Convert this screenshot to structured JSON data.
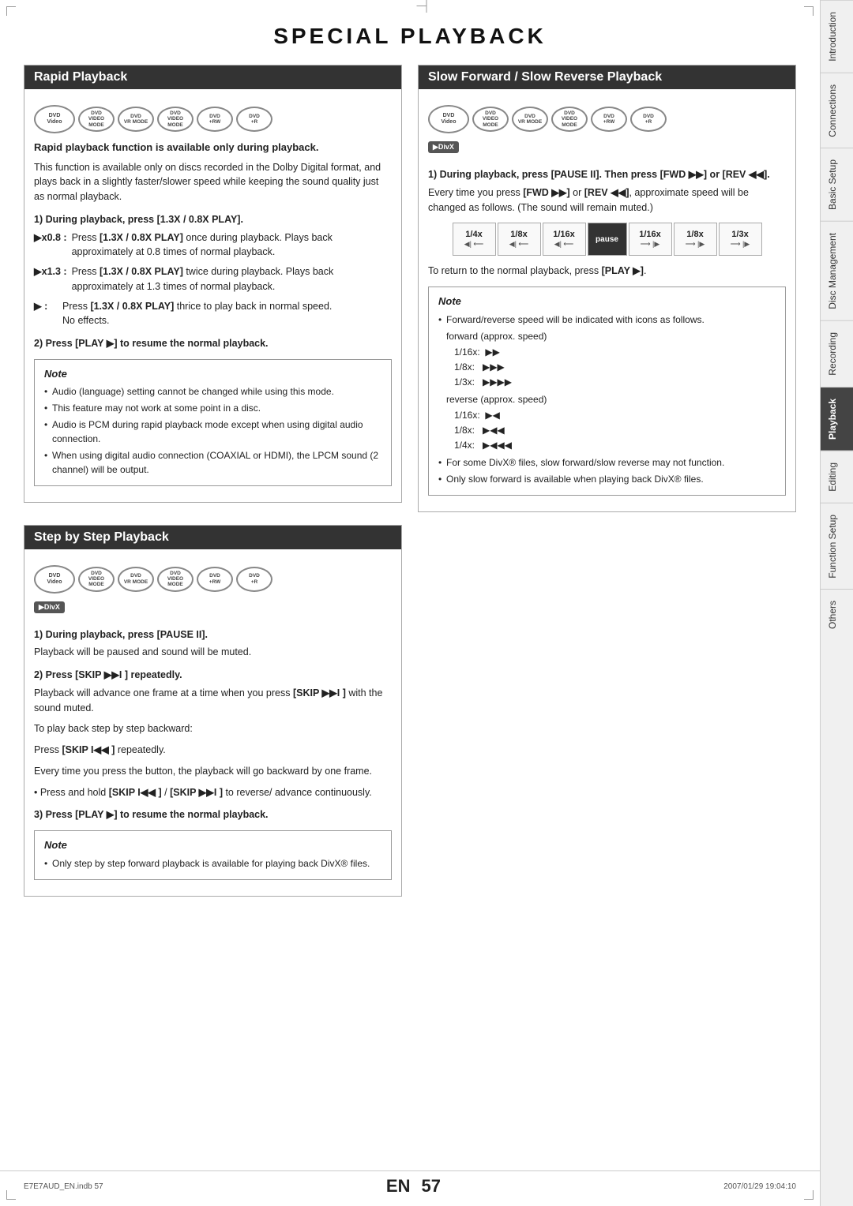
{
  "page": {
    "title": "SPECIAL PLAYBACK",
    "footer": {
      "left": "E7E7AUD_EN.indb  57",
      "right": "2007/01/29  19:04:10",
      "en_label": "EN",
      "page_number": "57"
    }
  },
  "sidebar": {
    "tabs": [
      {
        "id": "introduction",
        "label": "Introduction",
        "active": false
      },
      {
        "id": "connections",
        "label": "Connections",
        "active": false
      },
      {
        "id": "basic-setup",
        "label": "Basic Setup",
        "active": false
      },
      {
        "id": "disc-management",
        "label": "Disc Management",
        "active": false
      },
      {
        "id": "recording",
        "label": "Recording",
        "active": false
      },
      {
        "id": "playback",
        "label": "Playback",
        "active": true
      },
      {
        "id": "editing",
        "label": "Editing",
        "active": false
      },
      {
        "id": "function-setup",
        "label": "Function Setup",
        "active": false
      },
      {
        "id": "others",
        "label": "Others",
        "active": false
      }
    ]
  },
  "rapid_playback": {
    "header": "Rapid Playback",
    "dvd_icons": [
      "DVD Video",
      "DVD VIDEO MODE",
      "DVD VR MODE",
      "DVD VIDEO MODE",
      "DVD +RW",
      "DVD +R"
    ],
    "bold_intro": "Rapid playback function is available only during playback.",
    "intro_text": "This function is available only on discs recorded in the Dolby Digital format, and plays back in a slightly faster/slower speed while keeping the sound quality just as normal playback.",
    "step1_heading": "1) During playback, press [1.3X / 0.8X PLAY].",
    "bullets": [
      {
        "label": "▶x0.8 :",
        "text": "Press [1.3X / 0.8X PLAY] once during playback. Plays back approximately at 0.8 times of normal playback."
      },
      {
        "label": "▶x1.3 :",
        "text": "Press [1.3X / 0.8X PLAY] twice during playback. Plays back approximately at 1.3 times of normal playback."
      },
      {
        "label": "▶ :",
        "text": "Press [1.3X / 0.8X PLAY] thrice to play back in normal speed. No effects."
      }
    ],
    "step2_heading": "2) Press [PLAY ▶] to resume the normal playback.",
    "note_title": "Note",
    "notes": [
      "Audio (language) setting cannot be changed while using this mode.",
      "This feature may not work at some point in a disc.",
      "Audio is PCM during rapid playback mode except when using digital audio connection.",
      "When using digital audio connection (COAXIAL or HDMI), the LPCM sound (2 channel) will be output."
    ]
  },
  "slow_playback": {
    "header": "Slow Forward / Slow Reverse Playback",
    "dvd_icons": [
      "DVD Video",
      "DVD VIDEO MODE",
      "DVD VR MODE",
      "DVD VIDEO MODE",
      "DVD +RW",
      "DVD +R"
    ],
    "divx": "DivX",
    "step1_heading": "1) During playback, press [PAUSE II]. Then press [FWD ▶▶] or [REV ◀◀].",
    "step1_text": "Every time you press [FWD ▶▶] or [REV ◀◀], approximate speed will be changed as follows. (The sound will remain muted.)",
    "speed_labels": [
      "1/4x",
      "1/8x",
      "1/16x",
      "pause",
      "1/16x",
      "1/8x",
      "1/3x"
    ],
    "return_text": "To return to the normal playback, press [PLAY ▶].",
    "note_title": "Note",
    "notes": [
      "Forward/reverse speed will be indicated with icons as follows.",
      "forward (approx. speed)",
      "1/16x:  ▶▶",
      "1/8x:   ▶▶▶",
      "1/3x:   ▶▶▶▶",
      "reverse (approx. speed)",
      "1/16x:  ▶◀",
      "1/8x:   ▶◀◀",
      "1/4x:   ▶◀◀◀",
      "For some DivX® files, slow forward/slow reverse may not function.",
      "Only slow forward is available when playing back DivX® files."
    ]
  },
  "step_playback": {
    "header": "Step by Step Playback",
    "dvd_icons": [
      "DVD Video",
      "DVD VIDEO MODE",
      "DVD VR MODE",
      "DVD VIDEO MODE",
      "DVD +RW",
      "DVD +R"
    ],
    "divx": "DivX",
    "step1_heading": "1) During playback, press [PAUSE II].",
    "step1_text": "Playback will be paused and sound will be muted.",
    "step2_heading": "2) Press [SKIP ▶▶I ] repeatedly.",
    "step2_lines": [
      "Playback will advance one frame at a time when you press [SKIP ▶▶I ] with the sound muted.",
      "To play back step by step backward:",
      "Press [SKIP I◀◀ ] repeatedly.",
      "Every time you press the button, the playback will go backward by one frame.",
      "• Press and hold [SKIP I◀◀ ] / [SKIP ▶▶I ] to reverse/ advance continuously."
    ],
    "step3_heading": "3) Press [PLAY ▶] to resume the normal playback.",
    "note_title": "Note",
    "notes": [
      "Only step by step forward playback is available for playing back DivX® files."
    ]
  }
}
